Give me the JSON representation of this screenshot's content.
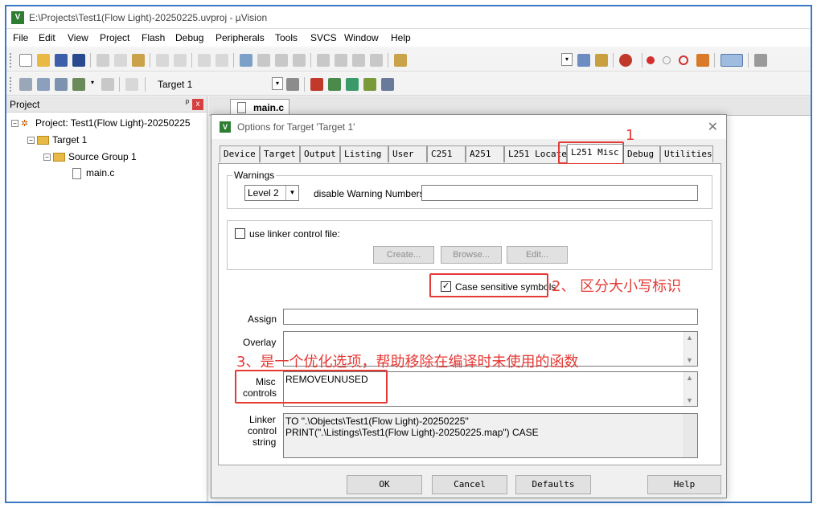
{
  "window": {
    "title": "E:\\Projects\\Test1(Flow Light)-20250225.uvproj - µVision"
  },
  "menu": [
    "File",
    "Edit",
    "View",
    "Project",
    "Flash",
    "Debug",
    "Peripherals",
    "Tools",
    "SVCS",
    "Window",
    "Help"
  ],
  "toolbar2": {
    "target_label": "Target 1"
  },
  "project_pane": {
    "title": "Project",
    "pin": "ᵖ",
    "close": "x",
    "root": "Project: Test1(Flow Light)-20250225",
    "target": "Target 1",
    "group": "Source Group 1",
    "file": "main.c"
  },
  "editor": {
    "tab": "main.c"
  },
  "dialog": {
    "title": "Options for Target 'Target 1'",
    "close": "✕",
    "tabs": [
      "Device",
      "Target",
      "Output",
      "Listing",
      "User",
      "C251",
      "A251",
      "L251 Locate",
      "L251 Misc",
      "Debug",
      "Utilities"
    ],
    "active_tab": "L251 Misc",
    "warnings": {
      "group_label": "Warnings",
      "level": "Level 2",
      "disable_label": "disable Warning Numbers:",
      "disable_value": ""
    },
    "linker_file": {
      "label": "use linker control file:",
      "checked": false,
      "create": "Create...",
      "browse": "Browse...",
      "edit": "Edit..."
    },
    "case_sensitive": {
      "label": "Case sensitive symbols",
      "checked": true,
      "mark": "✓"
    },
    "assign_label": "Assign",
    "overlay_label": "Overlay",
    "misc_label_1": "Misc",
    "misc_label_2": "controls",
    "misc_value": "REMOVEUNUSED",
    "linker_string_label_1": "Linker",
    "linker_string_label_2": "control",
    "linker_string_label_3": "string",
    "linker_string_line1": "TO \".\\Objects\\Test1(Flow Light)-20250225\"",
    "linker_string_line2": "PRINT(\".\\Listings\\Test1(Flow Light)-20250225.map\") CASE",
    "buttons": {
      "ok": "OK",
      "cancel": "Cancel",
      "defaults": "Defaults",
      "help": "Help"
    }
  },
  "annotations": {
    "a1": "1",
    "a2": "2、 区分大小写标识",
    "a3": "3、是一个优化选项，帮助移除在编译时未使用的函数"
  },
  "colors": {
    "annotation": "#e53935",
    "frame": "#3c78c4"
  }
}
